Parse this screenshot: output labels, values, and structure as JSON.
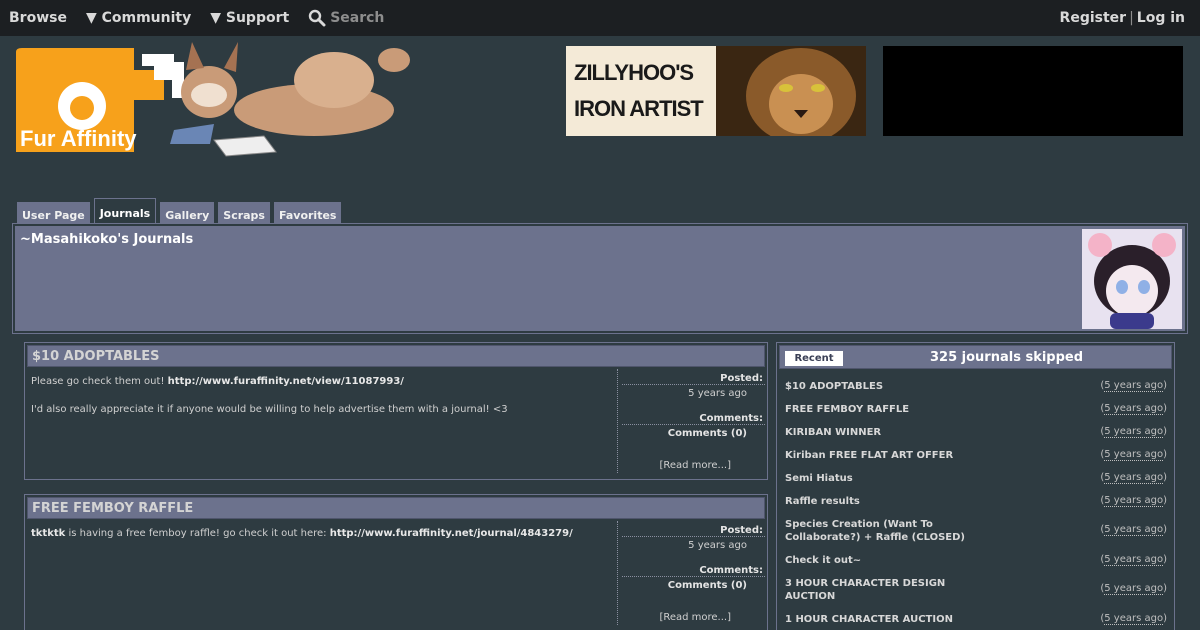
{
  "nav": {
    "browse": "Browse",
    "community": "▼ Community",
    "support": "▼ Support",
    "search": "Search",
    "register": "Register",
    "separator": "|",
    "login": "Log in"
  },
  "logo": {
    "text": "Fur Affinity"
  },
  "banner": {
    "line1": "ZILLYHOO'S",
    "line2": "IRON ARTIST"
  },
  "tabs": [
    "User Page",
    "Journals",
    "Gallery",
    "Scraps",
    "Favorites"
  ],
  "page_title": "~Masahikoko's Journals",
  "journals": [
    {
      "title": "$10 ADOPTABLES",
      "text1": "Please go check them out! ",
      "link1": "http://www.furaffinity.net/view/11087993/",
      "text2": "I'd also really appreciate it if anyone would be willing to help advertise them with a journal! <3",
      "posted_label": "Posted:",
      "posted": "5 years ago",
      "comments_label": "Comments:",
      "comments": "Comments (0)",
      "read_more": "[Read more...]"
    },
    {
      "title": "FREE FEMBOY RAFFLE",
      "user": "tktktk",
      "text1": " is having a free femboy raffle! go check it out here: ",
      "link1": "http://www.furaffinity.net/journal/4843279/",
      "posted_label": "Posted:",
      "posted": "5 years ago",
      "comments_label": "Comments:",
      "comments": "Comments (0)",
      "read_more": "[Read more...]"
    }
  ],
  "sidebar": {
    "tab": "Recent",
    "skipped": "325 journals skipped",
    "items": [
      {
        "name": "$10 ADOPTABLES",
        "age": "5 years ago"
      },
      {
        "name": "FREE FEMBOY RAFFLE",
        "age": "5 years ago"
      },
      {
        "name": "KIRIBAN WINNER",
        "age": "5 years ago"
      },
      {
        "name": "Kiriban FREE FLAT ART OFFER",
        "age": "5 years ago"
      },
      {
        "name": "Semi Hiatus",
        "age": "5 years ago"
      },
      {
        "name": "Raffle results",
        "age": "5 years ago"
      },
      {
        "name": "Species Creation (Want To Collaborate?) + Raffle (CLOSED)",
        "age": "5 years ago"
      },
      {
        "name": "Check it out~",
        "age": "5 years ago"
      },
      {
        "name": "3 HOUR CHARACTER DESIGN AUCTION",
        "age": "5 years ago"
      },
      {
        "name": "1 HOUR CHARACTER AUCTION",
        "age": "5 years ago"
      }
    ]
  }
}
